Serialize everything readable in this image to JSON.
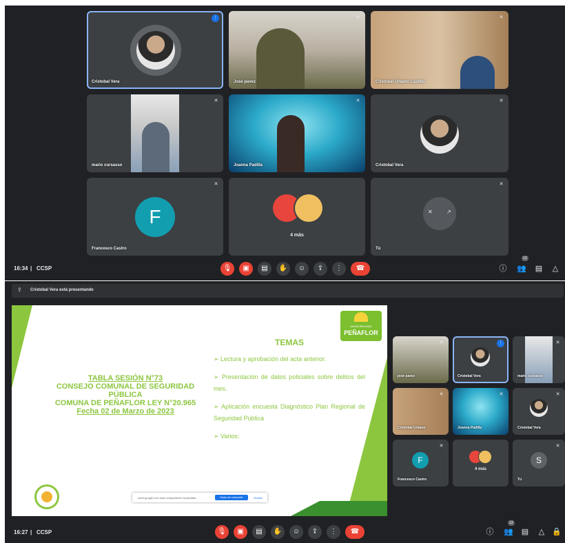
{
  "top": {
    "time": "16:34",
    "separator": "|",
    "meeting_code": "CCSP",
    "participants_badge": "12",
    "tiles": [
      {
        "name": "Cristobal Vera"
      },
      {
        "name": "José pavez"
      },
      {
        "name": "Cristobal Urbano Castilla"
      },
      {
        "name": "mario cursasso"
      },
      {
        "name": "Joanna Padilla"
      },
      {
        "name": "Cristobal Vera"
      },
      {
        "name": "Francesco Castro",
        "initial": "F"
      },
      {
        "name": "",
        "more_label": "4 más"
      },
      {
        "name": "Tú"
      }
    ]
  },
  "presenting": {
    "text": "Cristobal Vera está presentando"
  },
  "slide": {
    "title_lines": [
      "TABLA SESIÓN N°73",
      "CONSEJO COMUNAL DE SEGURIDAD",
      "PÚBLICA",
      "COMUNA DE PEÑAFLOR LEY N°20.965",
      "Fecha 02 de Marzo de 2023"
    ],
    "logo_text_1": "MUNICIPALIDAD",
    "logo_text_2": "PEÑAFLOR",
    "temas_heading": "TEMAS",
    "bullets": [
      "➢  Lectura y aprobación del acta anterior.",
      "➢  Presentación de datos policiales sobre delitos del mes.",
      "➢  Aplicación encuesta Diagnóstico Plan Regional de Seguridad Pública",
      "➢  Varios:"
    ],
    "share_banner": {
      "text": "meet.google.com está compartiendo la pantalla",
      "button": "Dejar de compartir",
      "hide": "Ocultar"
    }
  },
  "side": {
    "tiles": [
      {
        "name": "josé pavez"
      },
      {
        "name": "Cristobal Vera"
      },
      {
        "name": "mario cursasso"
      },
      {
        "name": "Cristobal Urbano"
      },
      {
        "name": "Joanna Padilla"
      },
      {
        "name": "Cristobal Vera"
      },
      {
        "name": "Francesco Castro",
        "initial": "F"
      },
      {
        "name": "",
        "more_label": "4 más"
      },
      {
        "name": "Tú",
        "initial": "S"
      }
    ]
  },
  "bottom": {
    "time": "16:27",
    "separator": "|",
    "meeting_code": "CCSP",
    "participants_badge": "12"
  },
  "colors": {
    "meet_bg": "#202124",
    "tile_bg": "#3c4043",
    "red": "#ea4335",
    "accent_blue": "#8ab4f8",
    "slide_green": "#8cc63f",
    "teal_avatar": "#129eaf"
  }
}
